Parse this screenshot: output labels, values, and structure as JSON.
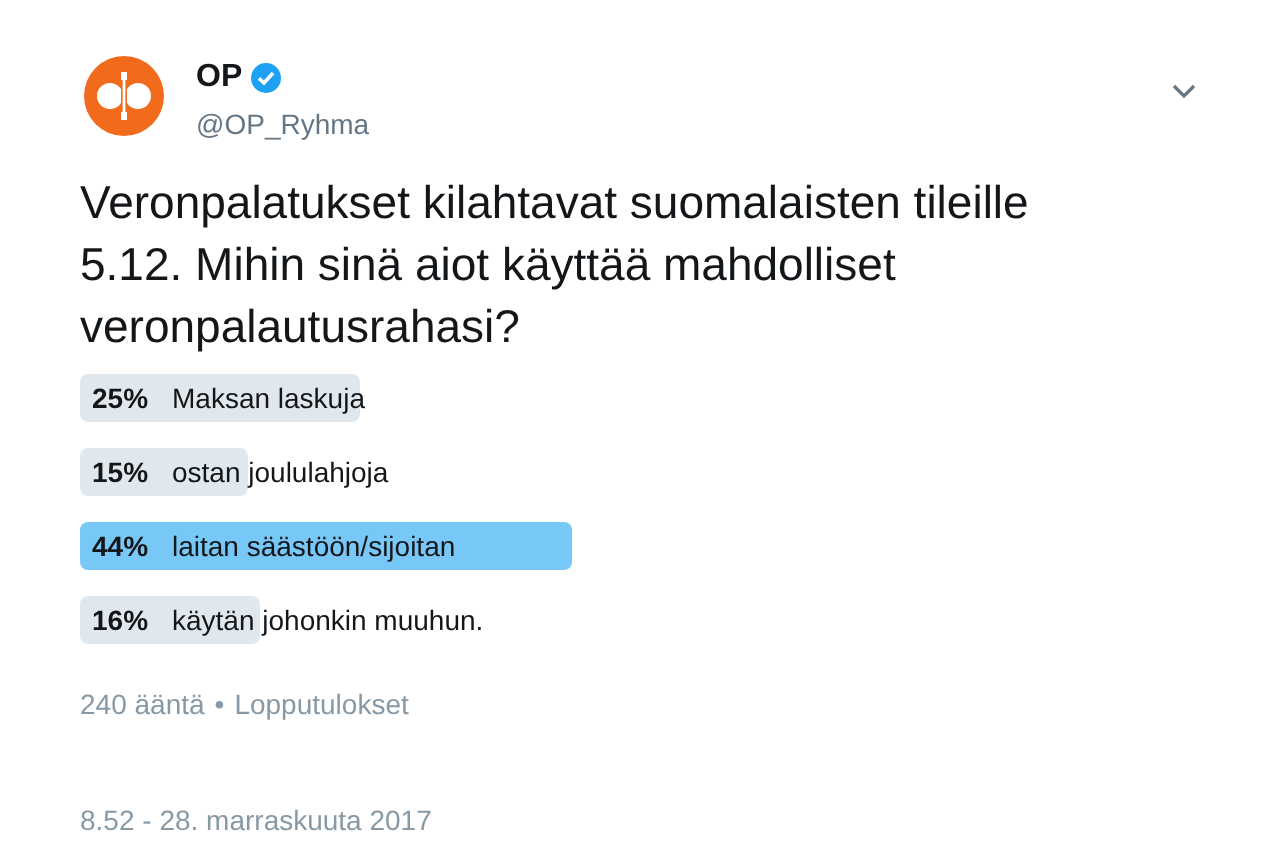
{
  "author": {
    "name": "OP",
    "verified": true,
    "handle": "@OP_Ryhma"
  },
  "text": "Veronpalatukset kilahtavat suomalaisten tileille 5.12. Mihin sinä aiot käyttää mahdolliset veronpalautusrahasi?",
  "poll": {
    "options": [
      {
        "percent": "25%",
        "label": "Maksan laskuja",
        "selected": false
      },
      {
        "percent": "15%",
        "label": "ostan joululahjoja",
        "selected": false
      },
      {
        "percent": "44%",
        "label": "laitan säästöön/sijoitan",
        "selected": true
      },
      {
        "percent": "16%",
        "label": "käytän johonkin muuhun.",
        "selected": false
      }
    ],
    "votes": "240 ääntä",
    "separator": "•",
    "status": "Lopputulokset"
  },
  "timestamp": "8.52 - 28. marraskuuta 2017"
}
